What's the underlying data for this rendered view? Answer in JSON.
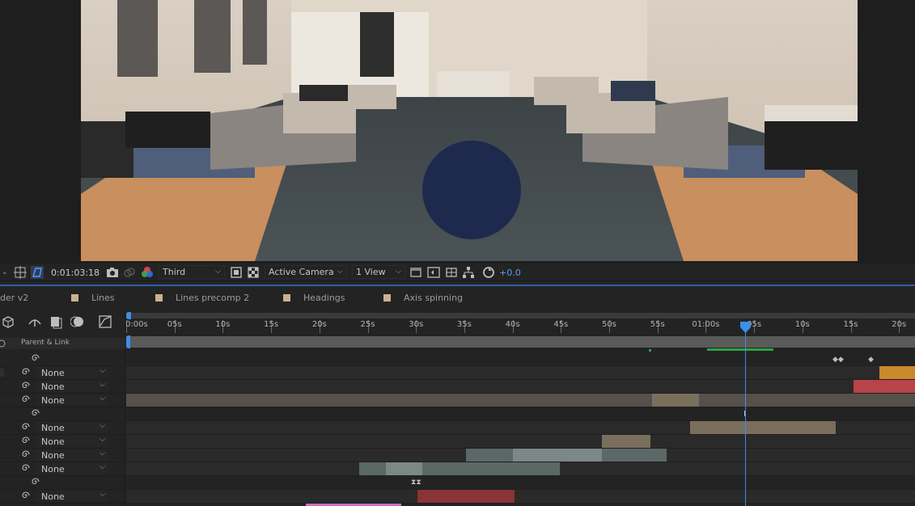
{
  "viewer": {
    "toolbar": {
      "timecode": "0:01:03:18",
      "view_layout_select": "Third",
      "camera_select": "Active Camera",
      "views_select": "1 View",
      "exposure_value": "+0.0"
    }
  },
  "tabs": [
    {
      "label": "der v2"
    },
    {
      "label": "Lines"
    },
    {
      "label": "Lines precomp 2"
    },
    {
      "label": "Headings"
    },
    {
      "label": "Axis spinning"
    }
  ],
  "left_panel": {
    "column_header": "Parent & Link",
    "rows": [
      {
        "parent": ""
      },
      {
        "parent": "None"
      },
      {
        "parent": "None"
      },
      {
        "parent": "None"
      },
      {
        "parent": ""
      },
      {
        "parent": "None"
      },
      {
        "parent": "None"
      },
      {
        "parent": "None"
      },
      {
        "parent": "None"
      },
      {
        "parent": ""
      },
      {
        "parent": "None"
      }
    ]
  },
  "timeline": {
    "ruler_labels": [
      "0:00s",
      "05s",
      "10s",
      "15s",
      "20s",
      "25s",
      "30s",
      "35s",
      "40s",
      "45s",
      "50s",
      "55s",
      "01:00s",
      "05s",
      "10s",
      "15s",
      "20s"
    ],
    "current_time_indicator_s": 64
  },
  "colors": {
    "accent": "#3d8ee8",
    "tab_swatch": "#c9b28f",
    "bar_orange": "#c88a2a",
    "bar_red": "#b8434a",
    "bar_tan": "#7a6e5d",
    "bar_gray": "#5f6e6c",
    "work_area_green": "#2ea043"
  }
}
